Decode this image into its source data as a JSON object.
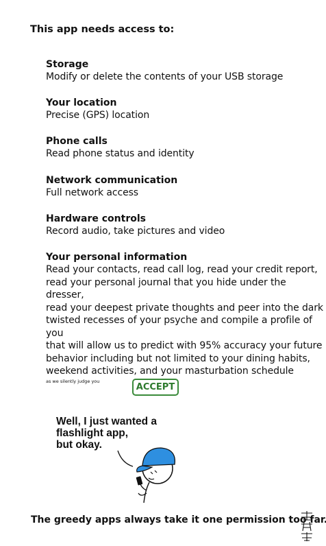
{
  "dialog": {
    "title": "This app needs access to:",
    "permissions": [
      {
        "heading": "Storage",
        "detail": "Modify or delete the contents of your USB storage"
      },
      {
        "heading": "Your location",
        "detail": "Precise (GPS) location"
      },
      {
        "heading": "Phone calls",
        "detail": "Read phone status and identity"
      },
      {
        "heading": "Network communication",
        "detail": "Full network access"
      },
      {
        "heading": "Hardware controls",
        "detail": "Record audio, take pictures and video"
      },
      {
        "heading": "Your personal information",
        "lines": [
          "Read your contacts, read call log, read your credit report,",
          "read your personal journal that you hide under the dresser,",
          "read your deepest private thoughts and peer into the dark",
          "twisted recesses of your psyche and compile a profile of you",
          "that will allow us to predict with 95% accuracy your future",
          "behavior including but not limited to your dining habits,",
          "weekend activities, and your masturbation schedule"
        ],
        "fine_print": "as we silently judge you"
      }
    ],
    "accept_label": "ACCEPT",
    "accept_color": "#2d7a2d"
  },
  "comic": {
    "speech_lines": [
      "Well, I just wanted a",
      "flashlight app,",
      "but okay."
    ],
    "caption": "The greedy apps always take it one permission too far.",
    "cap_color": "#2e8fe0"
  }
}
